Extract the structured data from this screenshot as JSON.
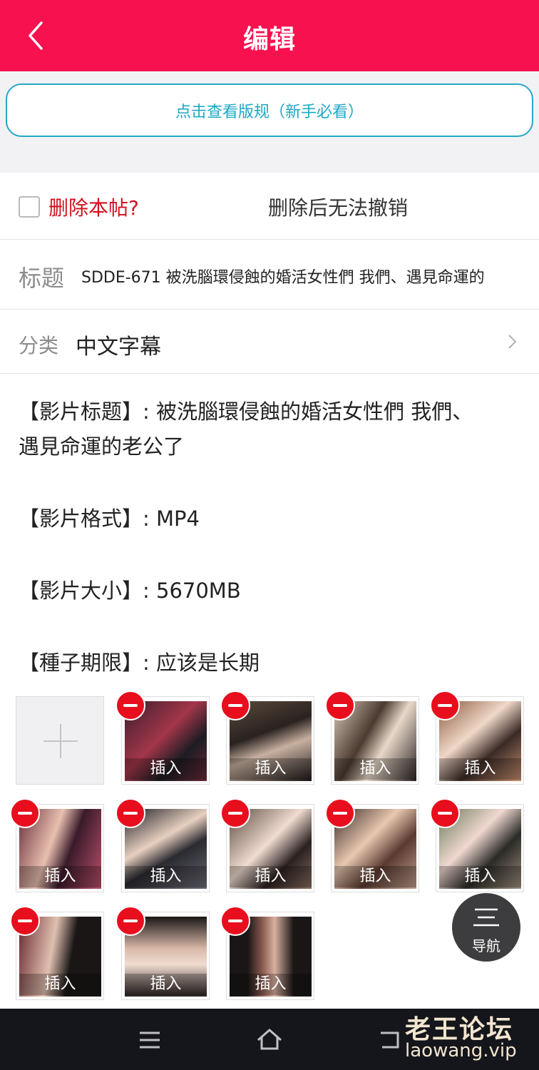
{
  "header": {
    "title": "编辑"
  },
  "rules_button": "点击查看版规（新手必看）",
  "delete": {
    "label": "删除本帖?",
    "note": "删除后无法撤销"
  },
  "title_field": {
    "label": "标题",
    "value": "SDDE-671 被洗腦環侵蝕的婚活女性們 我們、遇見命運的"
  },
  "category": {
    "label": "分类",
    "value": "中文字幕"
  },
  "content": {
    "line1": "【影片标题】: 被洗腦環侵蝕的婚活女性們 我們、",
    "line2": "遇見命運的老公了",
    "line3": "【影片格式】: MP4",
    "line4": "【影片大小】: 5670MB",
    "line5": "【種子期限】: 应该是长期"
  },
  "images": {
    "insert_label": "插入",
    "count": 13
  },
  "nav_button": {
    "label": "导航"
  },
  "watermark": {
    "brand": "老王论坛",
    "url": "laowang.vip"
  },
  "colors": {
    "header": "#f7114f",
    "accent": "#1fa7c6",
    "delete": "#e80e1d"
  }
}
